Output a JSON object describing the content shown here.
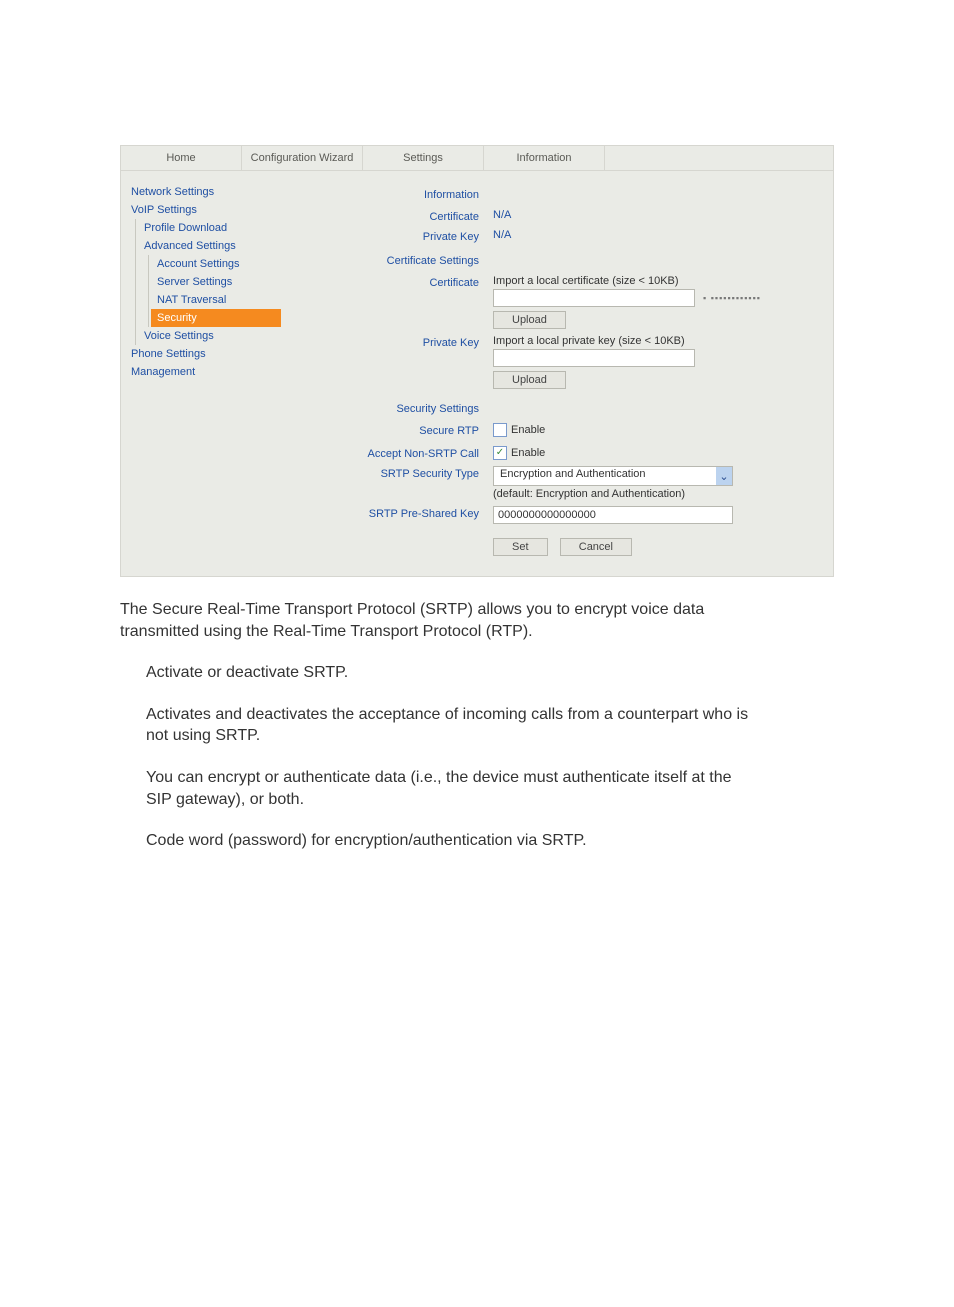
{
  "tabs": {
    "home": "Home",
    "wizard": "Configuration Wizard",
    "settings": "Settings",
    "information": "Information"
  },
  "sidebar": {
    "network": "Network Settings",
    "voip": "VoIP Settings",
    "profile_download": "Profile Download",
    "advanced": "Advanced Settings",
    "account": "Account Settings",
    "server": "Server Settings",
    "nat": "NAT Traversal",
    "security": "Security",
    "voice": "Voice Settings",
    "phone": "Phone Settings",
    "management": "Management"
  },
  "form": {
    "section_information": "Information",
    "certificate_label": "Certificate",
    "certificate_value": "N/A",
    "private_key_label": "Private Key",
    "private_key_value": "N/A",
    "section_cert_settings": "Certificate Settings",
    "cert_import_hint": "Import a local certificate (size < 10KB)",
    "pk_import_hint": "Import a local private key (size < 10KB)",
    "upload_btn": "Upload",
    "section_security_settings": "Security Settings",
    "secure_rtp_label": "Secure RTP",
    "accept_non_srtp_label": "Accept Non-SRTP Call",
    "enable_text": "Enable",
    "srtp_type_label": "SRTP Security Type",
    "srtp_type_value": "Encryption and Authentication",
    "srtp_type_default": "(default: Encryption and Authentication)",
    "srtp_psk_label": "SRTP Pre-Shared Key",
    "srtp_psk_value": "0000000000000000",
    "set_btn": "Set",
    "cancel_btn": "Cancel"
  },
  "doc": {
    "intro": "The Secure Real-Time Transport Protocol (SRTP) allows you to encrypt voice data transmitted using the Real-Time Transport Protocol (RTP).",
    "p1": "Activate or deactivate SRTP.",
    "p2": "Activates and deactivates the acceptance of incoming calls from a counterpart who is not using SRTP.",
    "p3": "You can encrypt or authenticate data (i.e., the device must authenticate itself at the SIP gateway), or both.",
    "p4": "Code word (password) for encryption/authentication via SRTP."
  }
}
